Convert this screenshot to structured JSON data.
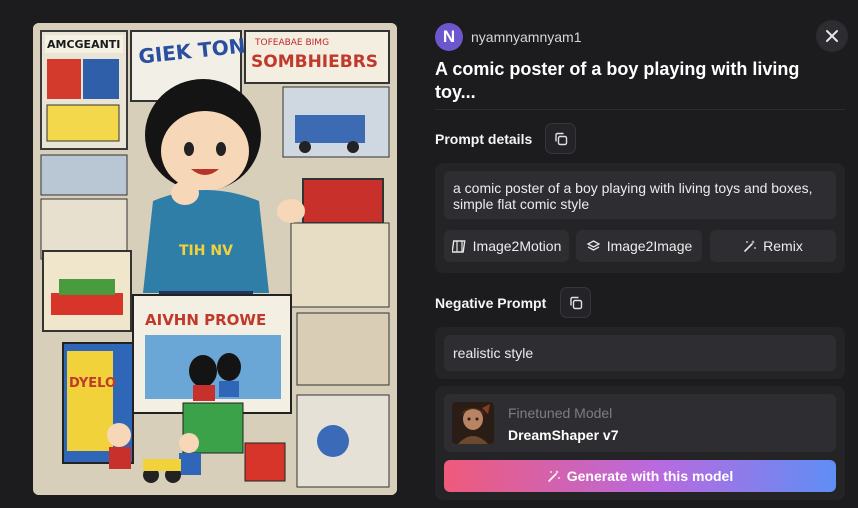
{
  "author": {
    "initial": "N",
    "username": "nyamnyamnyam1"
  },
  "post": {
    "title": "A comic poster of a boy playing with living toy..."
  },
  "prompt_details": {
    "label": "Prompt details",
    "text": "a comic poster of a boy playing with living toys and boxes, simple flat comic style",
    "actions": [
      {
        "label": "Image2Motion",
        "icon": "film-icon"
      },
      {
        "label": "Image2Image",
        "icon": "layers-icon"
      },
      {
        "label": "Remix",
        "icon": "magic-wand-icon"
      }
    ]
  },
  "negative_prompt": {
    "label": "Negative Prompt",
    "text": "realistic style"
  },
  "model": {
    "kicker": "Finetuned Model",
    "name": "DreamShaper v7",
    "generate_label": "Generate with this model"
  },
  "image_text": {
    "sign_top_left": "AMCGEANTI",
    "sign_top_center": "GIEK TONX",
    "sign_top_right_small": "TOFEABAE BIMG",
    "sign_top_right": "SOMBHIEBRS",
    "shirt": "TIH NV",
    "poster": "AIVHN PROWE",
    "box": "DYELO"
  },
  "colors": {
    "background": "#1c1c1e",
    "card": "#242427",
    "field": "#2e2e32",
    "avatar": "#6e56cf",
    "gradient_start": "#ef5a7a",
    "gradient_end": "#5f8ef5"
  }
}
